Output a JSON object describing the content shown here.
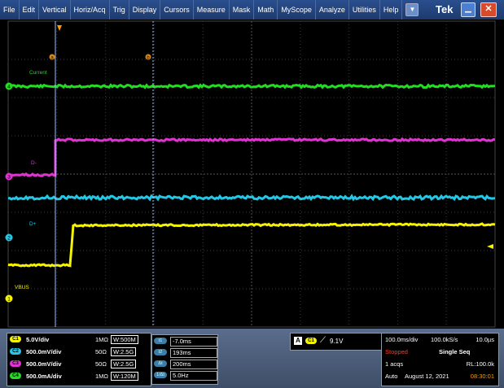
{
  "menubar": {
    "items": [
      "File",
      "Edit",
      "Vertical",
      "Horiz/Acq",
      "Trig",
      "Display",
      "Cursors",
      "Measure",
      "Mask",
      "Math",
      "MyScope",
      "Analyze",
      "Utilities",
      "Help"
    ],
    "dropdown_icon": "chevron-down-icon",
    "brand": "Tek",
    "minimize_icon": "minimize-icon",
    "close_icon": "close-icon"
  },
  "scope": {
    "labels": {
      "current": "Current",
      "dminus": "D-",
      "dplus": "D+",
      "vbus": "VBUS"
    },
    "cursor_a": "a",
    "cursor_b": "b",
    "ch_markers": [
      "4",
      "3",
      "2",
      "1"
    ],
    "colors": {
      "ch1": "#f4f400",
      "ch2": "#22c8e6",
      "ch3": "#e033d2",
      "ch4": "#22dd22",
      "cursor": "#9bc0ff",
      "trigger": "#ff9900"
    }
  },
  "channels": [
    {
      "badge": "C1",
      "scale": "5.0V/div",
      "impedance": "1MΩ",
      "bw": "W:500M",
      "color": "#f4f400"
    },
    {
      "badge": "C2",
      "scale": "500.0mV/div",
      "impedance": "50Ω",
      "bw": "W:2.5G",
      "color": "#22c8e6"
    },
    {
      "badge": "C3",
      "scale": "500.0mV/div",
      "impedance": "50Ω",
      "bw": "W:2.5G",
      "color": "#e033d2"
    },
    {
      "badge": "C4",
      "scale": "500.0mA/div",
      "impedance": "1MΩ",
      "bw": "W:120M",
      "color": "#22dd22"
    }
  ],
  "cursors": [
    {
      "badge": "t1",
      "value": "-7.0ms"
    },
    {
      "badge": "t2",
      "value": "193ms"
    },
    {
      "badge": "Δt",
      "value": "200ms"
    },
    {
      "badge": "1/Δt",
      "value": "5.0Hz"
    }
  ],
  "trigger": {
    "mode": "A",
    "source": "C1",
    "slope_icon": "rising-edge-icon",
    "level": "9.1V"
  },
  "acquisition": {
    "timebase": "100.0ms/div",
    "sample_rate": "100.0kS/s",
    "resolution": "10.0µs",
    "state": "Stopped",
    "mode": "Single Seq",
    "acqs": "1 acqs",
    "record_length": "RL:100.0k",
    "auto": "Auto",
    "date": "August 12, 2021",
    "time": "08:30:01"
  }
}
